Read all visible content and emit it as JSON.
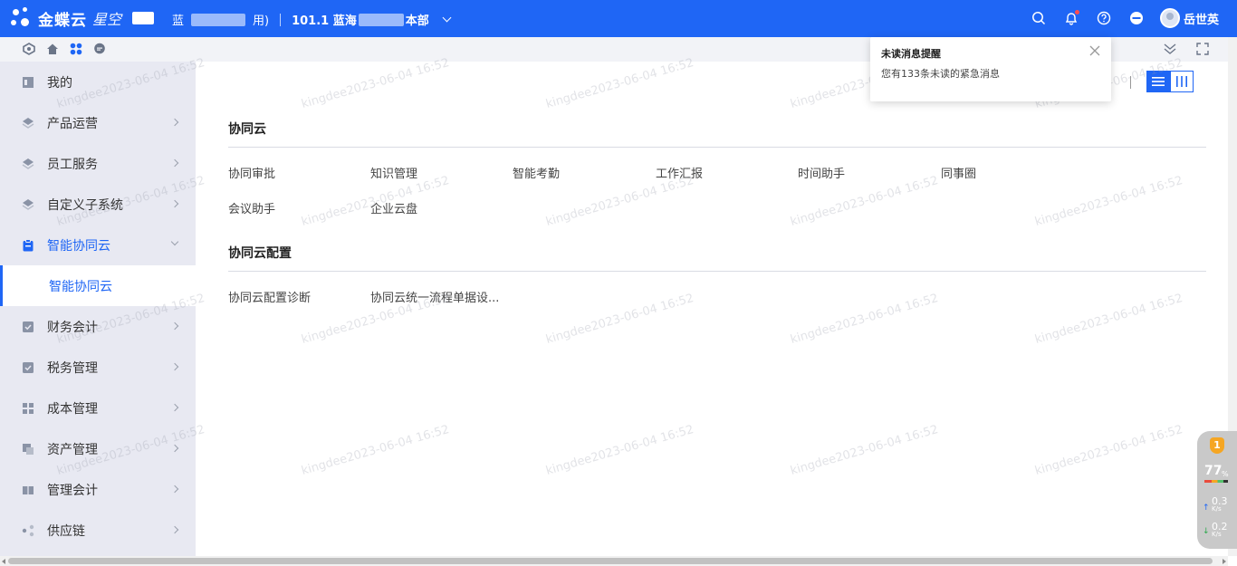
{
  "topbar": {
    "logo_text": "金蝶云",
    "logo_sub": "星空",
    "org_prefix": "蓝",
    "org_suffix": "用)",
    "org_code": "101.1 蓝海",
    "org_dept": "本部",
    "user_name": "岳世英"
  },
  "toast": {
    "title": "未读消息提醒",
    "body": "您有133条未读的紧急消息"
  },
  "sidebar": {
    "items": [
      {
        "label": "我的"
      },
      {
        "label": "产品运营"
      },
      {
        "label": "员工服务"
      },
      {
        "label": "自定义子系统"
      },
      {
        "label": "智能协同云"
      },
      {
        "label": "财务会计"
      },
      {
        "label": "税务管理"
      },
      {
        "label": "成本管理"
      },
      {
        "label": "资产管理"
      },
      {
        "label": "管理会计"
      },
      {
        "label": "供应链"
      }
    ],
    "sub_item": "智能协同云"
  },
  "main": {
    "sections": [
      {
        "title": "协同云",
        "links": [
          "协同审批",
          "知识管理",
          "智能考勤",
          "工作汇报",
          "时间助手",
          "同事圈",
          "会议助手",
          "企业云盘"
        ]
      },
      {
        "title": "协同云配置",
        "links": [
          "协同云配置诊断",
          "协同云统一流程单据设..."
        ]
      }
    ]
  },
  "watermark": "kingdee2023-06-04 16:52",
  "widget": {
    "badge": "1",
    "percent": "77",
    "percent_unit": "%",
    "up_value": "0.3",
    "up_unit": "K/s",
    "down_value": "0.2",
    "down_unit": "K/s"
  },
  "colors": {
    "brand": "#1f66f5",
    "sidebar_bg": "#e8e9f2",
    "notify_dot": "#ff4d4f"
  }
}
